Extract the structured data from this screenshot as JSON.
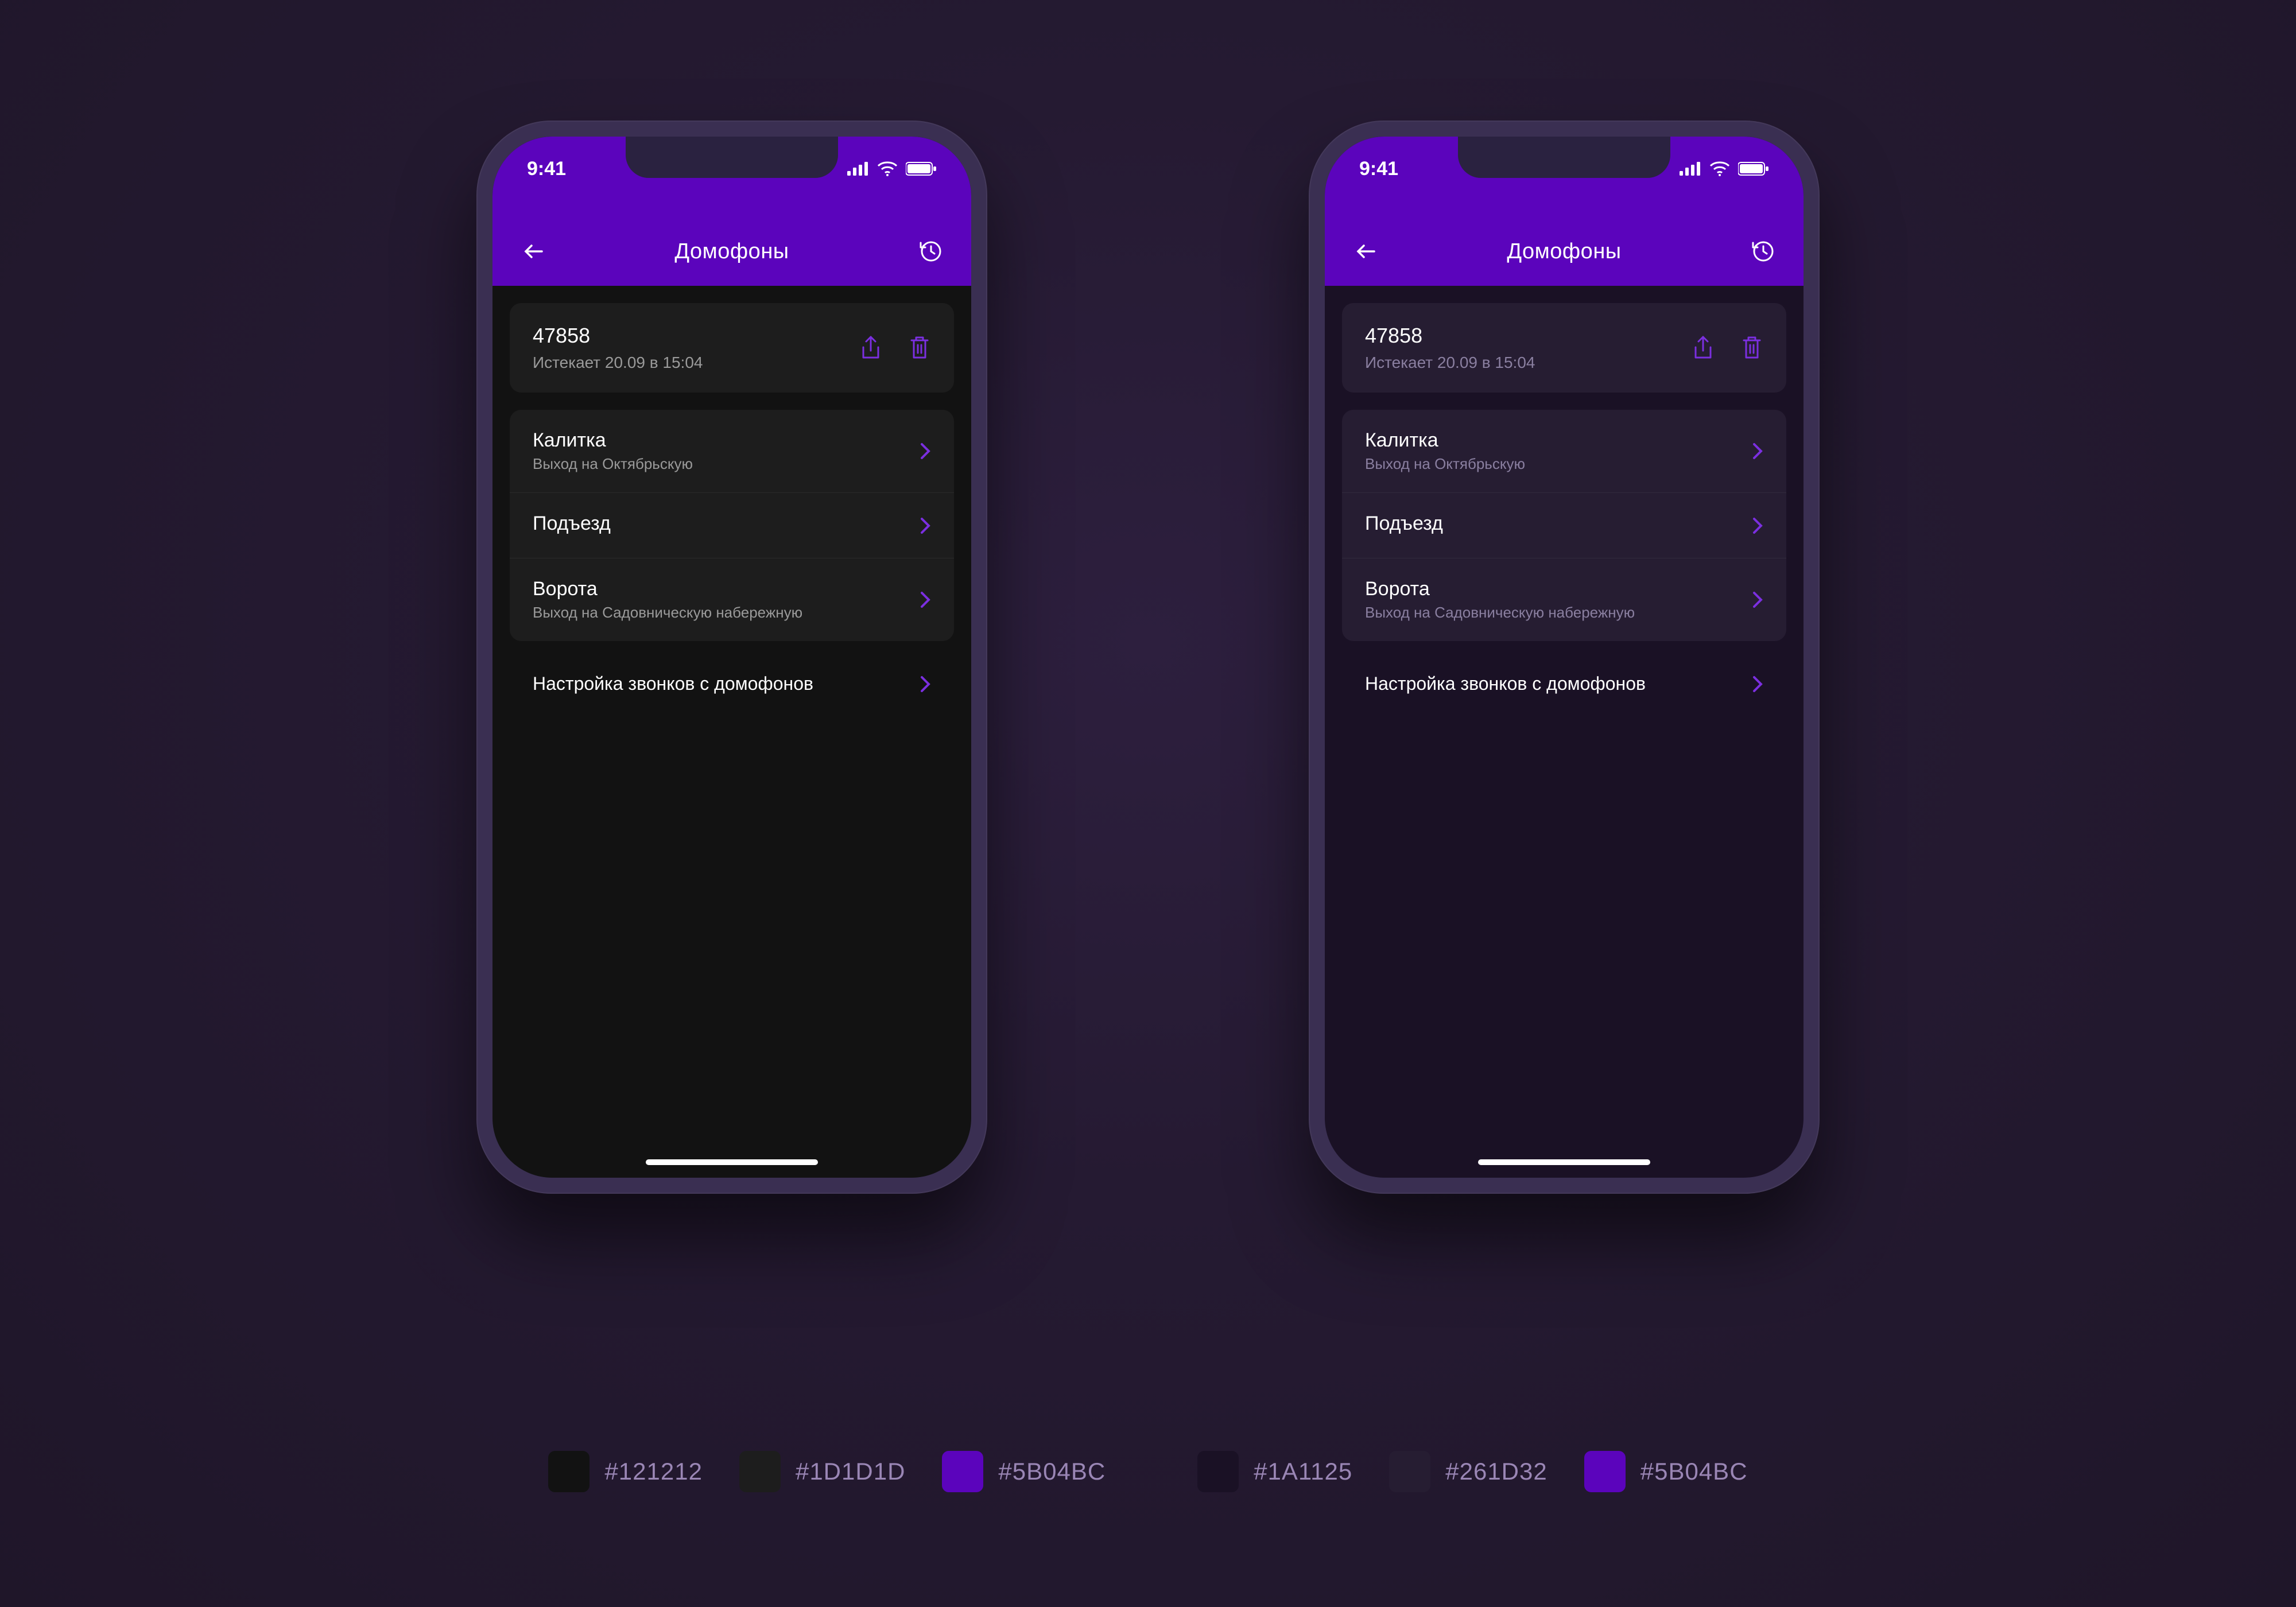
{
  "status": {
    "time": "9:41"
  },
  "header": {
    "title": "Домофоны"
  },
  "code_card": {
    "code": "47858",
    "expires": "Истекает 20.09 в 15:04"
  },
  "list": [
    {
      "title": "Калитка",
      "sub": "Выход на Октябрьскую"
    },
    {
      "title": "Подъезд",
      "sub": ""
    },
    {
      "title": "Ворота",
      "sub": "Выход на Садовническую набережную"
    }
  ],
  "settings_label": "Настройка звонков с домофонов",
  "palette_left": [
    {
      "hex": "#121212"
    },
    {
      "hex": "#1D1D1D"
    },
    {
      "hex": "#5B04BC"
    }
  ],
  "palette_right": [
    {
      "hex": "#1A1125"
    },
    {
      "hex": "#261D32"
    },
    {
      "hex": "#5B04BC"
    }
  ]
}
